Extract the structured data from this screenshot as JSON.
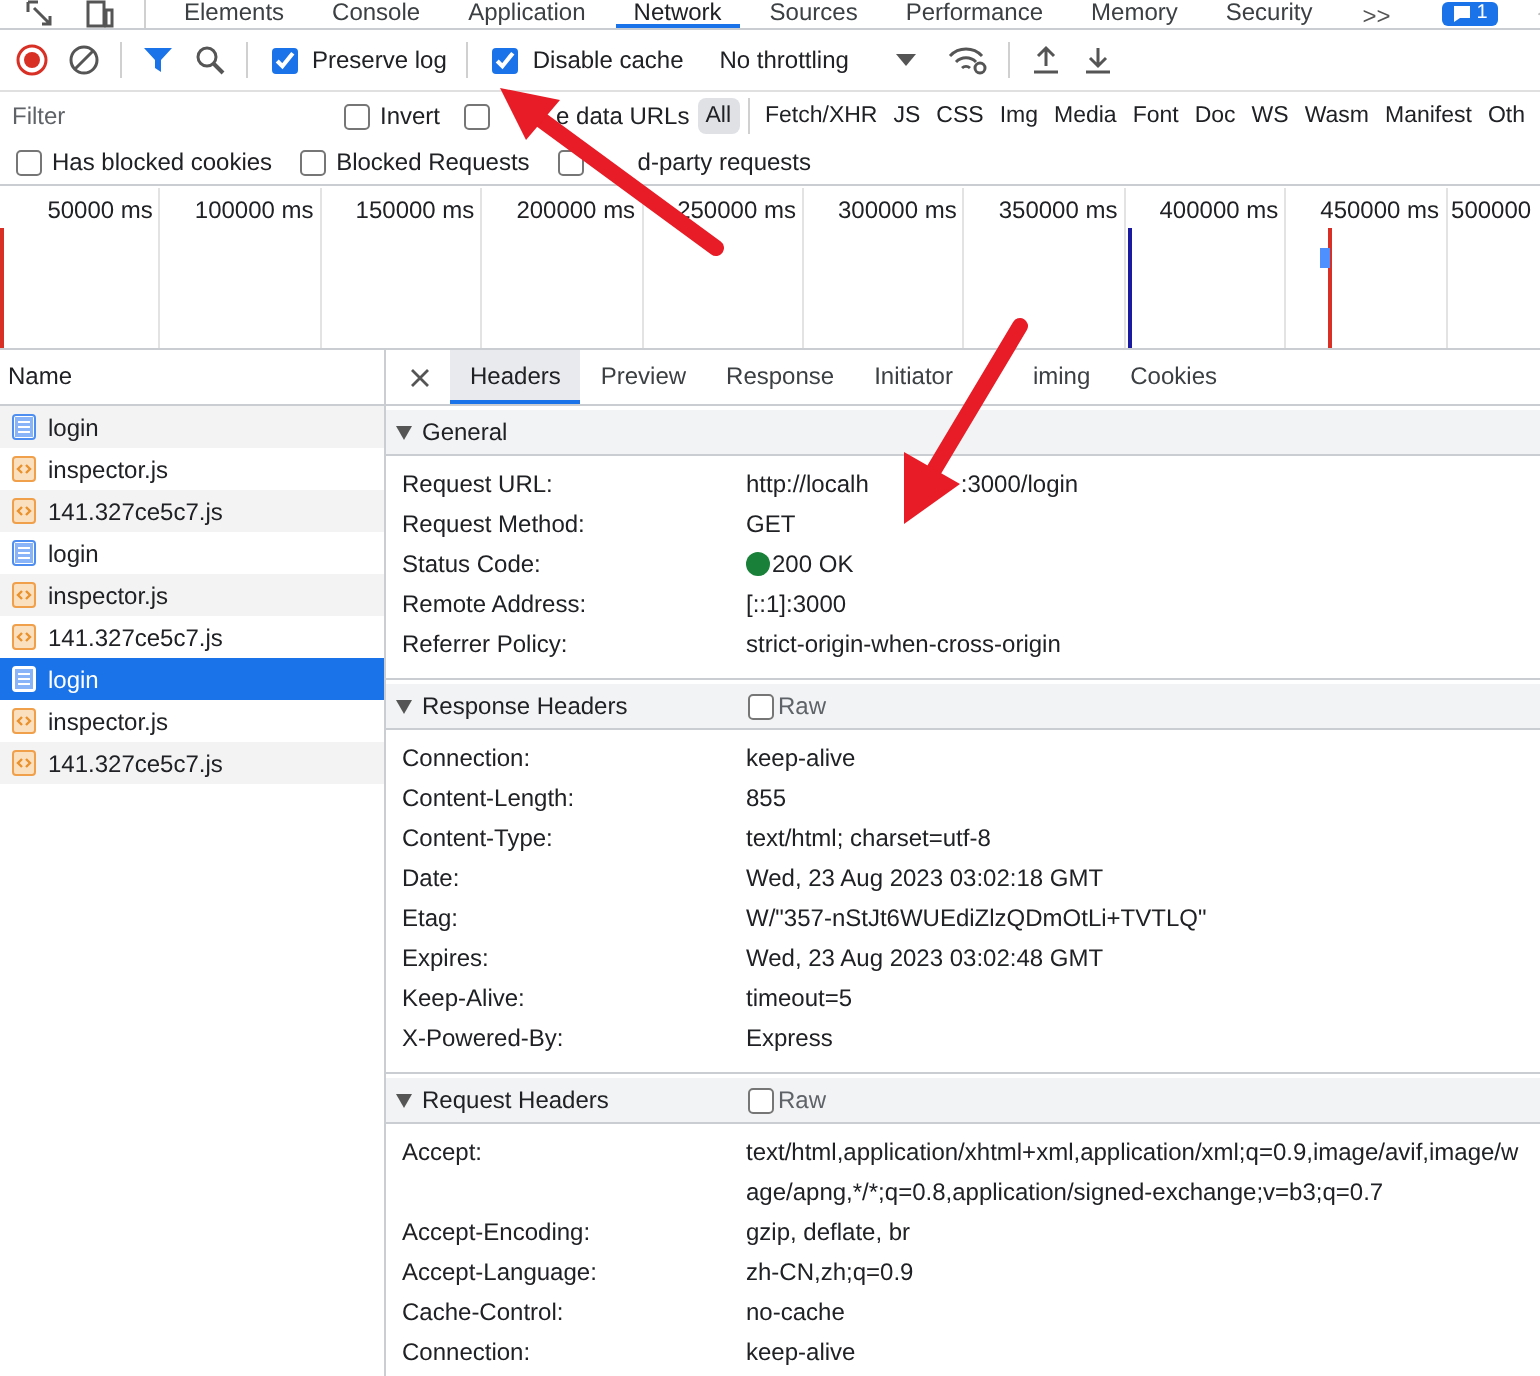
{
  "panel_tabs": [
    {
      "label": "Elements",
      "selected": false
    },
    {
      "label": "Console",
      "selected": false
    },
    {
      "label": "Application",
      "selected": false
    },
    {
      "label": "Network",
      "selected": true
    },
    {
      "label": "Sources",
      "selected": false
    },
    {
      "label": "Performance",
      "selected": false
    },
    {
      "label": "Memory",
      "selected": false
    },
    {
      "label": "Security",
      "selected": false
    }
  ],
  "more_tabs": ">>",
  "issues_count": "1",
  "toolbar": {
    "preserve_log": {
      "label": "Preserve log",
      "checked": true
    },
    "disable_cache": {
      "label": "Disable cache",
      "checked": true
    },
    "throttling": "No throttling"
  },
  "filter": {
    "placeholder": "Filter",
    "invert": {
      "label": "Invert",
      "checked": false
    },
    "hide_data_urls": {
      "label": "e data URLs",
      "checked": false
    },
    "types": [
      {
        "label": "All",
        "selected": true
      },
      {
        "label": "Fetch/XHR",
        "selected": false
      },
      {
        "label": "JS",
        "selected": false
      },
      {
        "label": "CSS",
        "selected": false
      },
      {
        "label": "Img",
        "selected": false
      },
      {
        "label": "Media",
        "selected": false
      },
      {
        "label": "Font",
        "selected": false
      },
      {
        "label": "Doc",
        "selected": false
      },
      {
        "label": "WS",
        "selected": false
      },
      {
        "label": "Wasm",
        "selected": false
      },
      {
        "label": "Manifest",
        "selected": false
      },
      {
        "label": "Oth",
        "selected": false
      }
    ]
  },
  "filter_checks": [
    {
      "label": "Has blocked cookies",
      "checked": false
    },
    {
      "label": "Blocked Requests",
      "checked": false
    },
    {
      "label": "d-party requests",
      "checked": false
    }
  ],
  "timeline": {
    "ticks": [
      "50000 ms",
      "100000 ms",
      "150000 ms",
      "200000 ms",
      "250000 ms",
      "300000 ms",
      "350000 ms",
      "400000 ms",
      "450000 ms",
      "500000"
    ]
  },
  "requests_header": "Name",
  "requests": [
    {
      "name": "login",
      "kind": "document",
      "selected": false
    },
    {
      "name": "inspector.js",
      "kind": "script",
      "selected": false
    },
    {
      "name": "141.327ce5c7.js",
      "kind": "script",
      "selected": false
    },
    {
      "name": "login",
      "kind": "document",
      "selected": false
    },
    {
      "name": "inspector.js",
      "kind": "script",
      "selected": false
    },
    {
      "name": "141.327ce5c7.js",
      "kind": "script",
      "selected": false
    },
    {
      "name": "login",
      "kind": "document",
      "selected": true
    },
    {
      "name": "inspector.js",
      "kind": "script",
      "selected": false
    },
    {
      "name": "141.327ce5c7.js",
      "kind": "script",
      "selected": false
    }
  ],
  "detail_tabs": [
    {
      "label": "Headers",
      "selected": true
    },
    {
      "label": "Preview",
      "selected": false
    },
    {
      "label": "Response",
      "selected": false
    },
    {
      "label": "Initiator",
      "selected": false
    },
    {
      "label": "iming",
      "selected": false
    },
    {
      "label": "Cookies",
      "selected": false
    }
  ],
  "sections": [
    {
      "title": "General",
      "rows": [
        {
          "name": "Request URL:",
          "value_parts": [
            "http://localh",
            ":3000/login"
          ]
        },
        {
          "name": "Request Method:",
          "value": "GET"
        },
        {
          "name": "Status Code:",
          "value": "200 OK",
          "color": "#188038"
        },
        {
          "name": "Remote Address:",
          "value": "[::1]:3000"
        },
        {
          "name": "Referrer Policy:",
          "value": "strict-origin-when-cross-origin"
        }
      ]
    },
    {
      "title": "Response Headers",
      "raw": {
        "label": "Raw",
        "checked": false
      },
      "rows": [
        {
          "name": "Connection:",
          "value": "keep-alive"
        },
        {
          "name": "Content-Length:",
          "value": "855"
        },
        {
          "name": "Content-Type:",
          "value": "text/html; charset=utf-8"
        },
        {
          "name": "Date:",
          "value": "Wed, 23 Aug 2023 03:02:18 GMT"
        },
        {
          "name": "Etag:",
          "value": "W/\"357-nStJt6WUEdiZlzQDmOtLi+TVTLQ\""
        },
        {
          "name": "Expires:",
          "value": "Wed, 23 Aug 2023 03:02:48 GMT"
        },
        {
          "name": "Keep-Alive:",
          "value": "timeout=5"
        },
        {
          "name": "X-Powered-By:",
          "value": "Express"
        }
      ]
    },
    {
      "title": "Request Headers",
      "raw": {
        "label": "Raw",
        "checked": false
      },
      "rows": [
        {
          "name": "Accept:",
          "value": [
            "text/html,application/xhtml+xml,application/xml;q=0.9,image/avif,image/w",
            "age/apng,*/*;q=0.8,application/signed-exchange;v=b3;q=0.7"
          ]
        },
        {
          "name": "Accept-Encoding:",
          "value": "gzip, deflate, br"
        },
        {
          "name": "Accept-Language:",
          "value": "zh-CN,zh;q=0.9"
        },
        {
          "name": "Cache-Control:",
          "value": "no-cache"
        },
        {
          "name": "Connection:",
          "value": "keep-alive"
        }
      ]
    }
  ]
}
